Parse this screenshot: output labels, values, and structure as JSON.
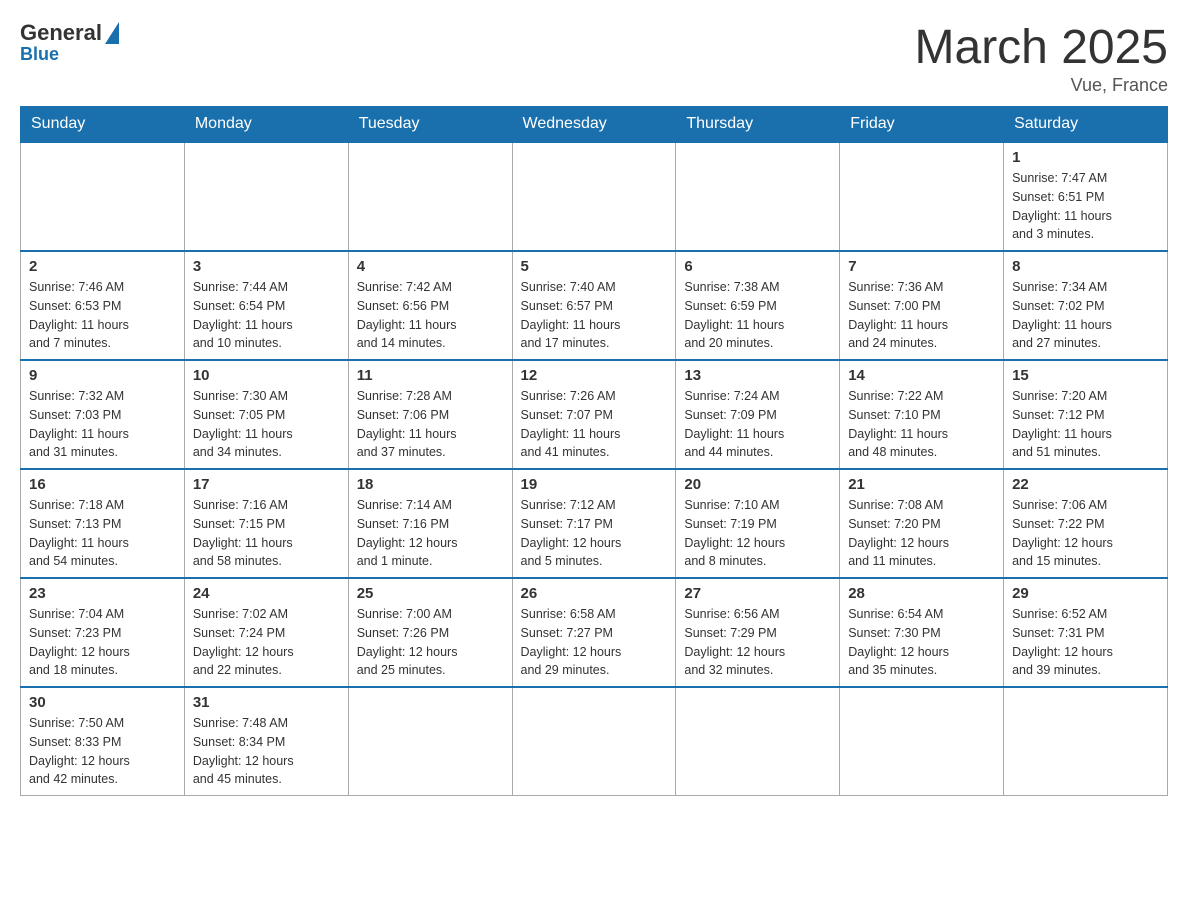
{
  "header": {
    "logo_general": "General",
    "logo_blue": "Blue",
    "month_year": "March 2025",
    "location": "Vue, France"
  },
  "days_of_week": [
    "Sunday",
    "Monday",
    "Tuesday",
    "Wednesday",
    "Thursday",
    "Friday",
    "Saturday"
  ],
  "weeks": [
    [
      {
        "day": "",
        "info": ""
      },
      {
        "day": "",
        "info": ""
      },
      {
        "day": "",
        "info": ""
      },
      {
        "day": "",
        "info": ""
      },
      {
        "day": "",
        "info": ""
      },
      {
        "day": "",
        "info": ""
      },
      {
        "day": "1",
        "info": "Sunrise: 7:47 AM\nSunset: 6:51 PM\nDaylight: 11 hours\nand 3 minutes."
      }
    ],
    [
      {
        "day": "2",
        "info": "Sunrise: 7:46 AM\nSunset: 6:53 PM\nDaylight: 11 hours\nand 7 minutes."
      },
      {
        "day": "3",
        "info": "Sunrise: 7:44 AM\nSunset: 6:54 PM\nDaylight: 11 hours\nand 10 minutes."
      },
      {
        "day": "4",
        "info": "Sunrise: 7:42 AM\nSunset: 6:56 PM\nDaylight: 11 hours\nand 14 minutes."
      },
      {
        "day": "5",
        "info": "Sunrise: 7:40 AM\nSunset: 6:57 PM\nDaylight: 11 hours\nand 17 minutes."
      },
      {
        "day": "6",
        "info": "Sunrise: 7:38 AM\nSunset: 6:59 PM\nDaylight: 11 hours\nand 20 minutes."
      },
      {
        "day": "7",
        "info": "Sunrise: 7:36 AM\nSunset: 7:00 PM\nDaylight: 11 hours\nand 24 minutes."
      },
      {
        "day": "8",
        "info": "Sunrise: 7:34 AM\nSunset: 7:02 PM\nDaylight: 11 hours\nand 27 minutes."
      }
    ],
    [
      {
        "day": "9",
        "info": "Sunrise: 7:32 AM\nSunset: 7:03 PM\nDaylight: 11 hours\nand 31 minutes."
      },
      {
        "day": "10",
        "info": "Sunrise: 7:30 AM\nSunset: 7:05 PM\nDaylight: 11 hours\nand 34 minutes."
      },
      {
        "day": "11",
        "info": "Sunrise: 7:28 AM\nSunset: 7:06 PM\nDaylight: 11 hours\nand 37 minutes."
      },
      {
        "day": "12",
        "info": "Sunrise: 7:26 AM\nSunset: 7:07 PM\nDaylight: 11 hours\nand 41 minutes."
      },
      {
        "day": "13",
        "info": "Sunrise: 7:24 AM\nSunset: 7:09 PM\nDaylight: 11 hours\nand 44 minutes."
      },
      {
        "day": "14",
        "info": "Sunrise: 7:22 AM\nSunset: 7:10 PM\nDaylight: 11 hours\nand 48 minutes."
      },
      {
        "day": "15",
        "info": "Sunrise: 7:20 AM\nSunset: 7:12 PM\nDaylight: 11 hours\nand 51 minutes."
      }
    ],
    [
      {
        "day": "16",
        "info": "Sunrise: 7:18 AM\nSunset: 7:13 PM\nDaylight: 11 hours\nand 54 minutes."
      },
      {
        "day": "17",
        "info": "Sunrise: 7:16 AM\nSunset: 7:15 PM\nDaylight: 11 hours\nand 58 minutes."
      },
      {
        "day": "18",
        "info": "Sunrise: 7:14 AM\nSunset: 7:16 PM\nDaylight: 12 hours\nand 1 minute."
      },
      {
        "day": "19",
        "info": "Sunrise: 7:12 AM\nSunset: 7:17 PM\nDaylight: 12 hours\nand 5 minutes."
      },
      {
        "day": "20",
        "info": "Sunrise: 7:10 AM\nSunset: 7:19 PM\nDaylight: 12 hours\nand 8 minutes."
      },
      {
        "day": "21",
        "info": "Sunrise: 7:08 AM\nSunset: 7:20 PM\nDaylight: 12 hours\nand 11 minutes."
      },
      {
        "day": "22",
        "info": "Sunrise: 7:06 AM\nSunset: 7:22 PM\nDaylight: 12 hours\nand 15 minutes."
      }
    ],
    [
      {
        "day": "23",
        "info": "Sunrise: 7:04 AM\nSunset: 7:23 PM\nDaylight: 12 hours\nand 18 minutes."
      },
      {
        "day": "24",
        "info": "Sunrise: 7:02 AM\nSunset: 7:24 PM\nDaylight: 12 hours\nand 22 minutes."
      },
      {
        "day": "25",
        "info": "Sunrise: 7:00 AM\nSunset: 7:26 PM\nDaylight: 12 hours\nand 25 minutes."
      },
      {
        "day": "26",
        "info": "Sunrise: 6:58 AM\nSunset: 7:27 PM\nDaylight: 12 hours\nand 29 minutes."
      },
      {
        "day": "27",
        "info": "Sunrise: 6:56 AM\nSunset: 7:29 PM\nDaylight: 12 hours\nand 32 minutes."
      },
      {
        "day": "28",
        "info": "Sunrise: 6:54 AM\nSunset: 7:30 PM\nDaylight: 12 hours\nand 35 minutes."
      },
      {
        "day": "29",
        "info": "Sunrise: 6:52 AM\nSunset: 7:31 PM\nDaylight: 12 hours\nand 39 minutes."
      }
    ],
    [
      {
        "day": "30",
        "info": "Sunrise: 7:50 AM\nSunset: 8:33 PM\nDaylight: 12 hours\nand 42 minutes."
      },
      {
        "day": "31",
        "info": "Sunrise: 7:48 AM\nSunset: 8:34 PM\nDaylight: 12 hours\nand 45 minutes."
      },
      {
        "day": "",
        "info": ""
      },
      {
        "day": "",
        "info": ""
      },
      {
        "day": "",
        "info": ""
      },
      {
        "day": "",
        "info": ""
      },
      {
        "day": "",
        "info": ""
      }
    ]
  ]
}
